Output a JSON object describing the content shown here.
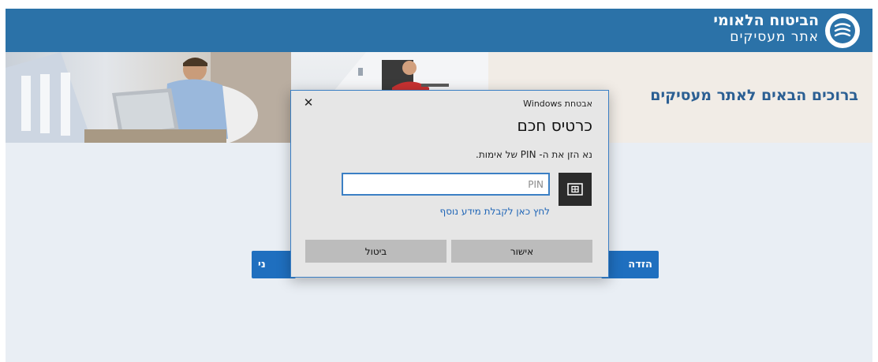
{
  "header": {
    "brand_main": "הביטוח הלאומי",
    "brand_sub": "אתר מעסיקים",
    "logo_icon": "nii-logo-icon",
    "bg_color": "#2b72a8"
  },
  "hero": {
    "welcome": "ברוכים הבאים לאתר מעסיקים"
  },
  "buttons": {
    "right_label": "הזדה",
    "left_label": "ני"
  },
  "dialog": {
    "caption": "אבטחת Windows",
    "close_glyph": "✕",
    "title": "כרטיס חכם",
    "prompt": "נא הזן את ה- PIN של אימות.",
    "pin_placeholder": "PIN",
    "pin_value": "",
    "more_info_link": "לחץ כאן לקבלת מידע נוסף",
    "ok_label": "אישור",
    "cancel_label": "ביטול",
    "card_icon": "smart-card-icon",
    "accent_color": "#3b7fc4"
  }
}
